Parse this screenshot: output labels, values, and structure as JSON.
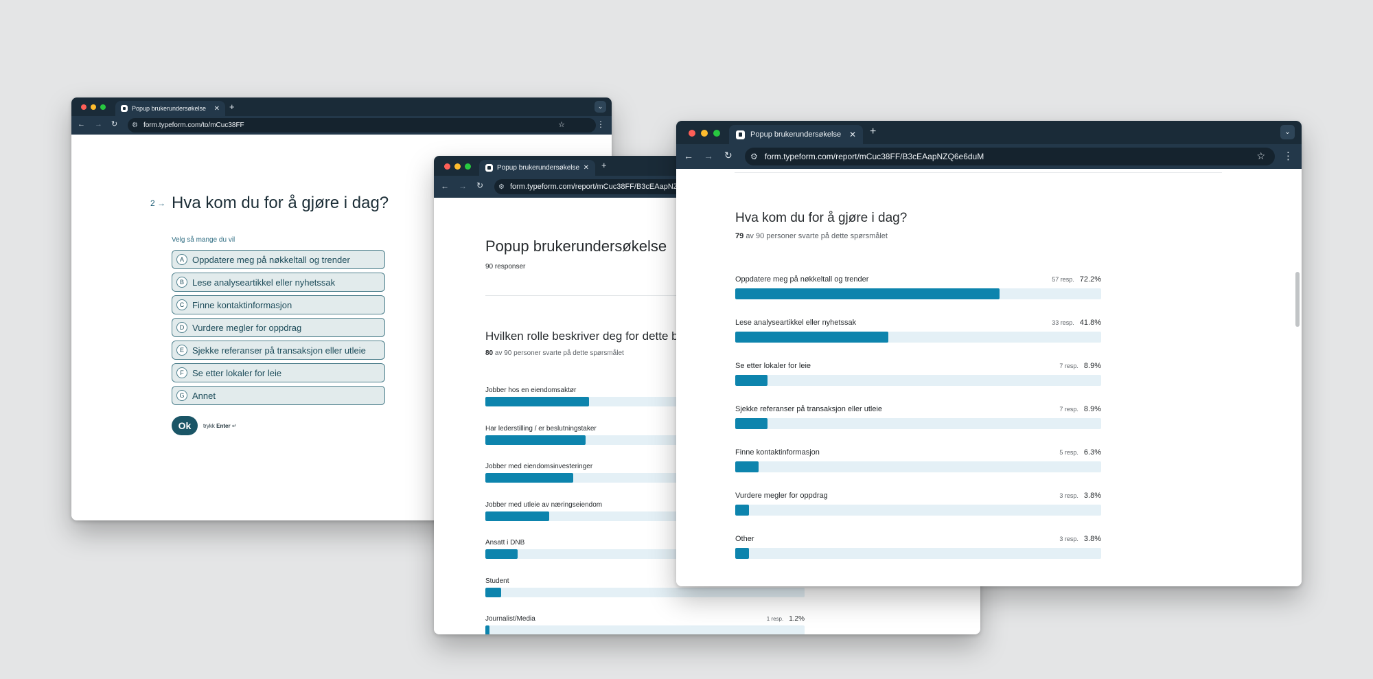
{
  "colors": {
    "background": "#e4e5e6",
    "chrome_dark": "#1a2b38",
    "bar_fill": "#0d84ad",
    "bar_track": "#e4f0f6",
    "accent": "#1a5566"
  },
  "form_window": {
    "tab_title": "Popup brukerundersøkelse",
    "url": "form.typeform.com/to/mCuc38FF",
    "question_number": "2",
    "question": "Hva kom du for å gjøre i dag?",
    "hint": "Velg så mange du vil",
    "options": [
      {
        "key": "A",
        "label": "Oppdatere meg på nøkkeltall og trender"
      },
      {
        "key": "B",
        "label": "Lese analyseartikkel eller nyhetssak"
      },
      {
        "key": "C",
        "label": "Finne kontaktinformasjon"
      },
      {
        "key": "D",
        "label": "Vurdere megler for oppdrag"
      },
      {
        "key": "E",
        "label": "Sjekke referanser på transaksjon eller utleie"
      },
      {
        "key": "F",
        "label": "Se etter lokaler for leie"
      },
      {
        "key": "G",
        "label": "Annet"
      }
    ],
    "ok_label": "Ok",
    "ok_hint_prefix": "trykk",
    "ok_hint_key": "Enter",
    "ok_hint_symbol": "↵"
  },
  "report_window_1": {
    "tab_title": "Popup brukerundersøkelse",
    "url": "form.typeform.com/report/mCuc38FF/B3cEAapNZQ6e6duM",
    "title": "Popup brukerundersøkelse",
    "responses": "90 responser",
    "question": "Hvilken rolle beskriver deg for dette besøket?",
    "answered_count": "80",
    "answered_text": "av 90 personer svarte på dette spørsmålet",
    "rows": [
      {
        "label": "Jobber hos en eiendomsaktør",
        "resp": "",
        "pct": "",
        "value": 32.5
      },
      {
        "label": "Har lederstilling / er beslutningstaker",
        "resp": "",
        "pct": "",
        "value": 31.3
      },
      {
        "label": "Jobber med eiendomsinvesteringer",
        "resp": "",
        "pct": "",
        "value": 27.5
      },
      {
        "label": "Jobber med utleie av næringseiendom",
        "resp": "",
        "pct": "",
        "value": 20.0
      },
      {
        "label": "Ansatt i DNB",
        "resp": "",
        "pct": "",
        "value": 10.0
      },
      {
        "label": "Student",
        "resp": "",
        "pct": "",
        "value": 5.0
      },
      {
        "label": "Journalist/Media",
        "resp": "1 resp.",
        "pct": "1.2%",
        "value": 1.2
      }
    ]
  },
  "report_window_2": {
    "tab_title": "Popup brukerundersøkelse",
    "url": "form.typeform.com/report/mCuc38FF/B3cEAapNZQ6e6duM",
    "question": "Hva kom du for å gjøre i dag?",
    "answered_count": "79",
    "answered_text": "av 90 personer svarte på dette spørsmålet",
    "rows": [
      {
        "label": "Oppdatere meg på nøkkeltall og trender",
        "resp": "57 resp.",
        "pct": "72.2%",
        "value": 72.2
      },
      {
        "label": "Lese analyseartikkel eller nyhetssak",
        "resp": "33 resp.",
        "pct": "41.8%",
        "value": 41.8
      },
      {
        "label": "Se etter lokaler for leie",
        "resp": "7 resp.",
        "pct": "8.9%",
        "value": 8.9
      },
      {
        "label": "Sjekke referanser på transaksjon eller utleie",
        "resp": "7 resp.",
        "pct": "8.9%",
        "value": 8.9
      },
      {
        "label": "Finne kontaktinformasjon",
        "resp": "5 resp.",
        "pct": "6.3%",
        "value": 6.3
      },
      {
        "label": "Vurdere megler for oppdrag",
        "resp": "3 resp.",
        "pct": "3.8%",
        "value": 3.8
      },
      {
        "label": "Other",
        "resp": "3 resp.",
        "pct": "3.8%",
        "value": 3.8
      }
    ]
  }
}
